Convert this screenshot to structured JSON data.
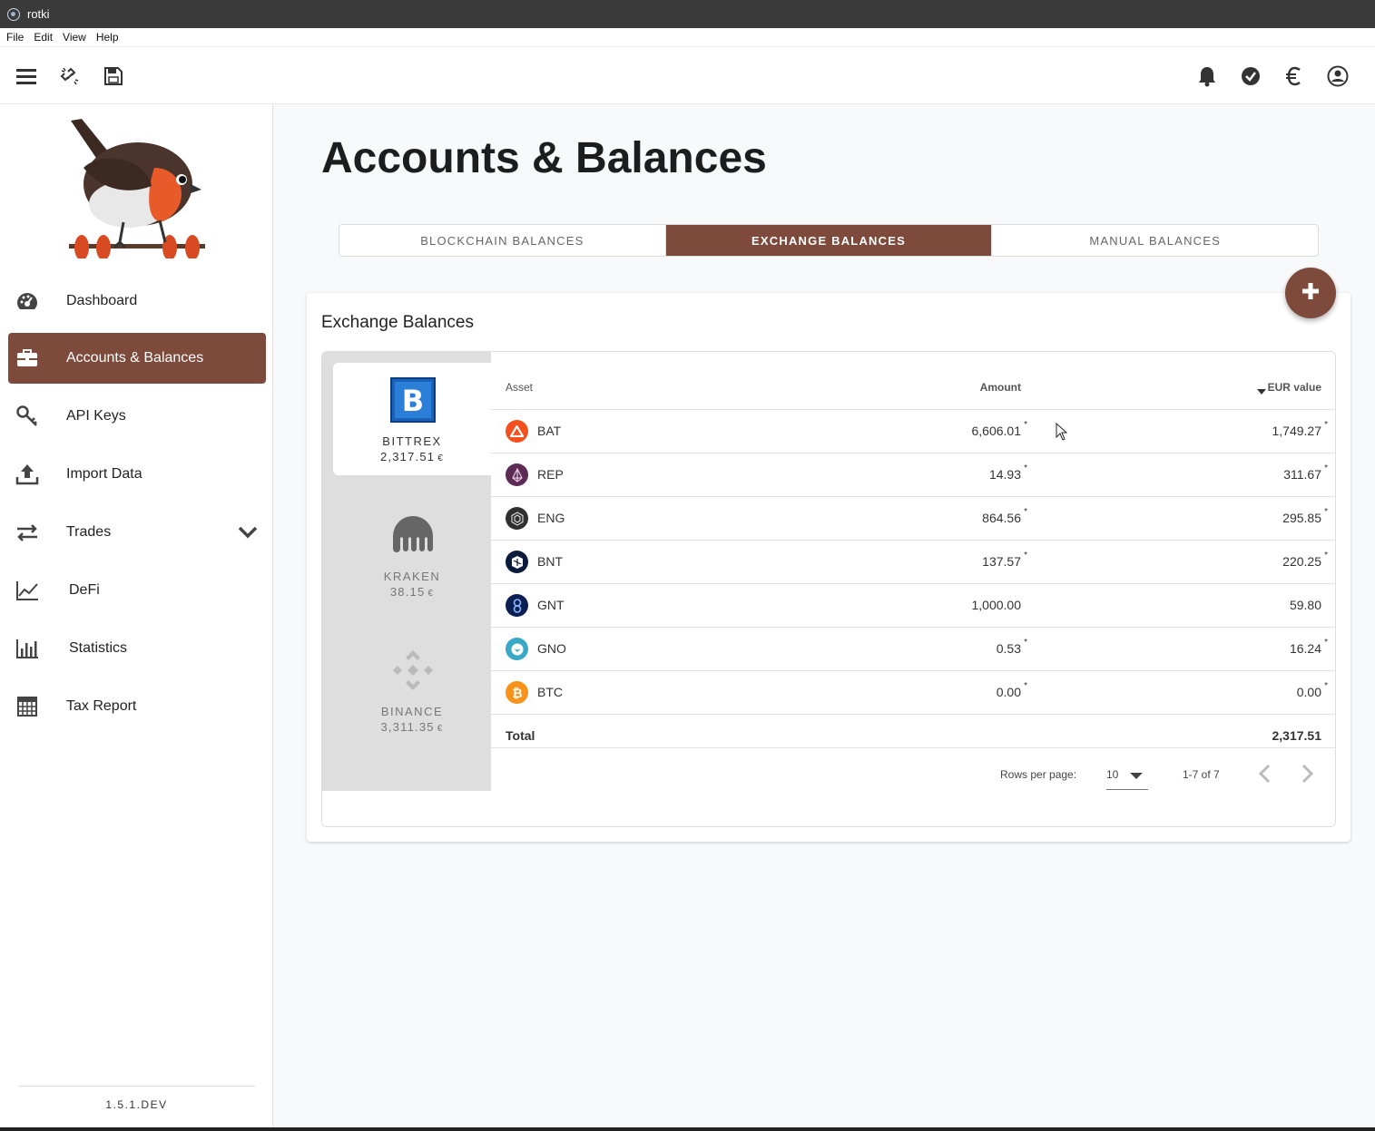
{
  "window": {
    "title": "rotki"
  },
  "menu": [
    "File",
    "Edit",
    "View",
    "Help"
  ],
  "sidebar": {
    "items": [
      {
        "label": "Dashboard",
        "icon": "dashboard-icon"
      },
      {
        "label": "Accounts & Balances",
        "icon": "briefcase-icon",
        "active": true
      },
      {
        "label": "API Keys",
        "icon": "key-icon"
      },
      {
        "label": "Import Data",
        "icon": "upload-icon"
      },
      {
        "label": "Trades",
        "icon": "swap-icon"
      },
      {
        "label": "DeFi",
        "icon": "chart-line-icon"
      },
      {
        "label": "Statistics",
        "icon": "bar-chart-icon"
      },
      {
        "label": "Tax Report",
        "icon": "calculator-icon"
      }
    ],
    "version": "1.5.1.DEV"
  },
  "page": {
    "title": "Accounts & Balances"
  },
  "tabs": [
    {
      "label": "BLOCKCHAIN BALANCES"
    },
    {
      "label": "EXCHANGE BALANCES",
      "active": true
    },
    {
      "label": "MANUAL BALANCES"
    }
  ],
  "card": {
    "title": "Exchange Balances"
  },
  "exchanges": [
    {
      "name": "BITTREX",
      "value": "2,317.51",
      "currency": "€"
    },
    {
      "name": "KRAKEN",
      "value": "38.15",
      "currency": "€"
    },
    {
      "name": "BINANCE",
      "value": "3,311.35",
      "currency": "€"
    }
  ],
  "table": {
    "headers": {
      "asset": "Asset",
      "amount": "Amount",
      "value": "EUR value"
    },
    "rows": [
      {
        "asset": "BAT",
        "amount": "6,606.01",
        "value": "1,749.27",
        "star_amount": "*",
        "star_value": "*",
        "color": "#f4511e"
      },
      {
        "asset": "REP",
        "amount": "14.93",
        "value": "311.67",
        "star_amount": "*",
        "star_value": "*",
        "color": "#5b2a55"
      },
      {
        "asset": "ENG",
        "amount": "864.56",
        "value": "295.85",
        "star_amount": "*",
        "star_value": "*",
        "color": "#2f2f2f"
      },
      {
        "asset": "BNT",
        "amount": "137.57",
        "value": "220.25",
        "star_amount": "*",
        "star_value": "*",
        "color": "#0b1b3b"
      },
      {
        "asset": "GNT",
        "amount": "1,000.00",
        "value": "59.80",
        "star_amount": "",
        "star_value": "",
        "color": "#0a1f52"
      },
      {
        "asset": "GNO",
        "amount": "0.53",
        "value": "16.24",
        "star_amount": "*",
        "star_value": "*",
        "color": "#3aa9c7"
      },
      {
        "asset": "BTC",
        "amount": "0.00",
        "value": "0.00",
        "star_amount": "*",
        "star_value": "*",
        "color": "#f7931a"
      }
    ],
    "total": {
      "label": "Total",
      "value": "2,317.51"
    },
    "footer": {
      "rows_per_page_label": "Rows per page:",
      "rows_per_page": "10",
      "range": "1-7 of 7"
    }
  },
  "colors": {
    "accent": "#7e4a3b"
  }
}
